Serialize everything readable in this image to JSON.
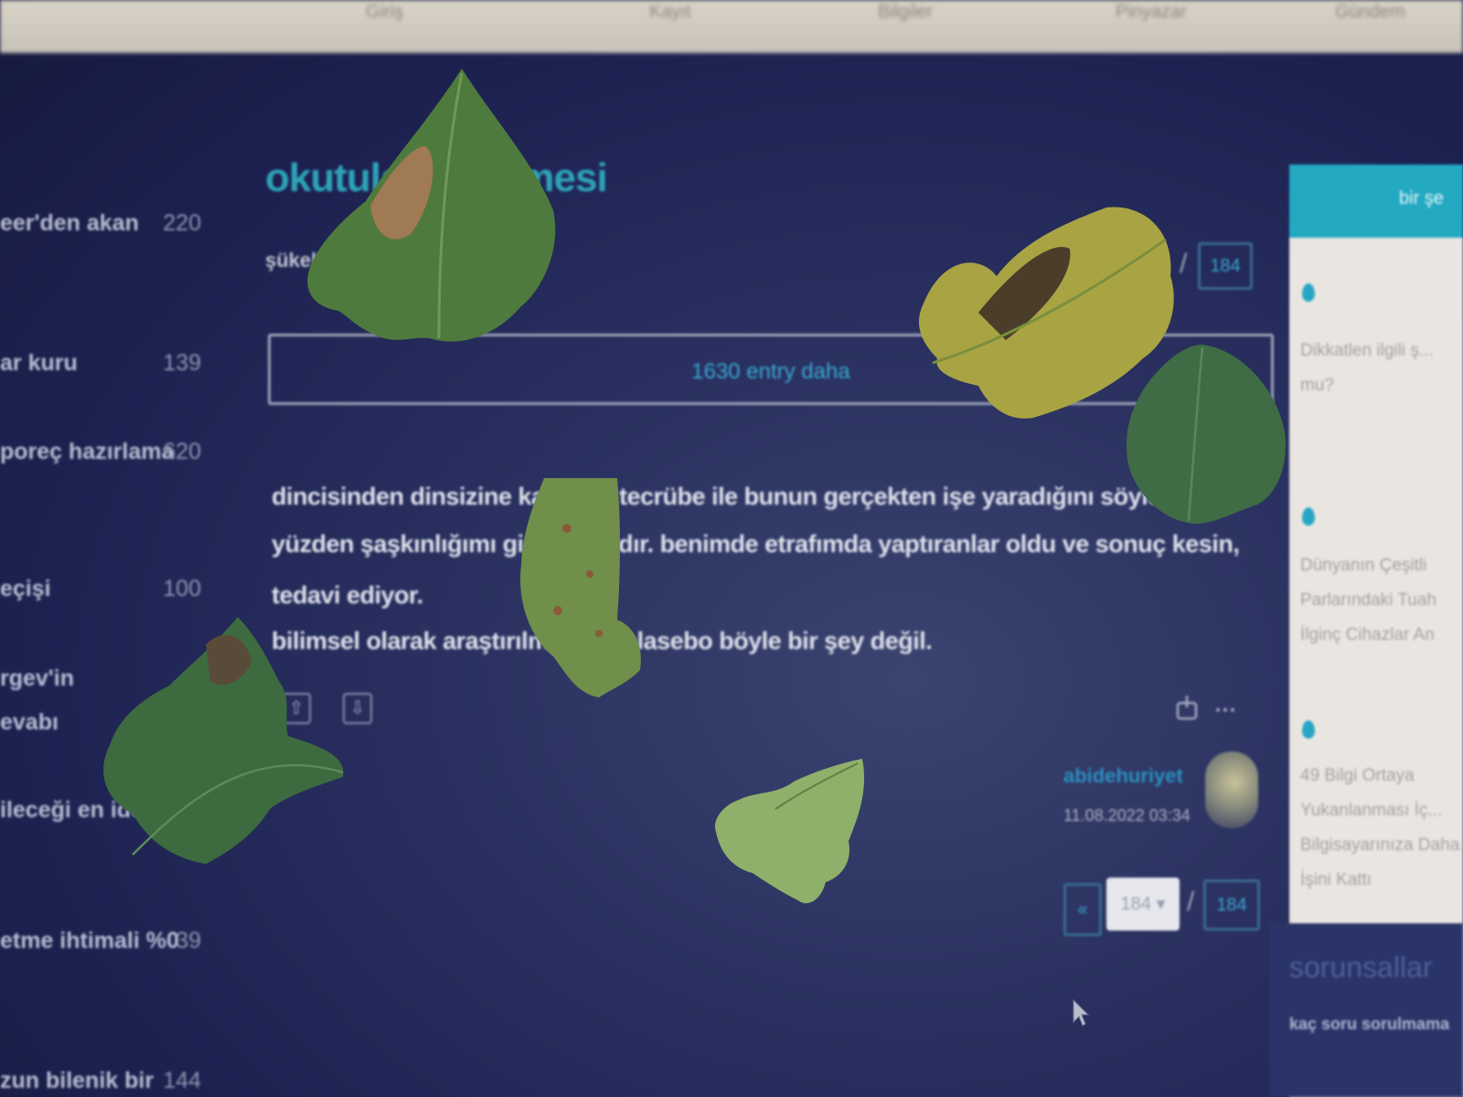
{
  "top_nav": {
    "items": [
      "Giriş",
      "Kayıt",
      "Bilgiler",
      "Pinyazar",
      "Gündem"
    ]
  },
  "sidebar": {
    "items": [
      {
        "label": "eer'den akan",
        "count": "220"
      },
      {
        "label": "ar kuru",
        "count": "139"
      },
      {
        "label": "poreç hazırlama",
        "count": "620"
      },
      {
        "label": "eçişi",
        "count": "100"
      },
      {
        "label": "rgev'in",
        "count": ""
      },
      {
        "label": "evabı",
        "count": ""
      },
      {
        "label": "ileceği en ide",
        "count": ""
      },
      {
        "label": "etme ihtimali %0",
        "count": "39"
      },
      {
        "label": "zun bilenik bir",
        "count": "144"
      }
    ]
  },
  "topic": {
    "title": "okutular... ileşmesi",
    "subtitle": "şükel",
    "page_total": "184",
    "more_entries": "1630 entry daha"
  },
  "entry": {
    "lines": [
      "dincisinden dinsizine kad...sin tecrübe ile bunun gerçekten işe yaradığını söyleoğ",
      "yüzden şaşkınlığımı gi...m olaydır. benimde etrafımda yaptıranlar oldu ve sonuç kesin,",
      "tedavi ediyor.",
      "bilimsel olarak araştırılma...eni plasebo böyle bir şey değil."
    ],
    "author": "abidehuriyet",
    "date": "11.08.2022 03:34"
  },
  "pagination": {
    "prev": "«",
    "current": "184",
    "separator": "/",
    "total": "184"
  },
  "right_panel": {
    "header": "bir şe",
    "items": [
      "Dikkatlen ilgili ş... mu?",
      "Dünyanın Çeşitli Parlarındaki Tuah İlginç Cihazlar An",
      "49 Bilgi Ortaya Yukanlanması İç... Bilgisayarınıza Daha İşini Kattı"
    ],
    "bottom_title": "sorunsallar",
    "bottom_sub": "kaç soru sorulmama"
  },
  "colors": {
    "title": "#2fa3b8",
    "link": "#39a8d2",
    "panel_accent": "#24a9c2",
    "background": "#1c2150"
  }
}
